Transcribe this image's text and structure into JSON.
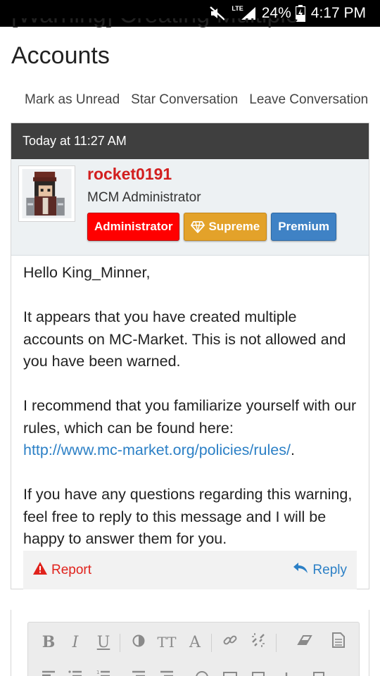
{
  "status_bar": {
    "battery": "24%",
    "time": "4:17 PM",
    "network": "LTE"
  },
  "thread": {
    "title_partial": "[Warning] Creating Multiple",
    "title_line2": "Accounts"
  },
  "actions": {
    "mark_unread": "Mark as Unread",
    "star": "Star Conversation",
    "leave": "Leave Conversation"
  },
  "message": {
    "date": "Today at 11:27 AM",
    "author": {
      "username": "rocket0191",
      "title": "MCM Administrator",
      "badges": {
        "admin": "Administrator",
        "supreme": "Supreme",
        "premium": "Premium"
      }
    },
    "body": {
      "greeting": "Hello King_Minner,",
      "p1": "It appears that you have created multiple accounts on MC-Market. This is not allowed and you have been warned.",
      "p2_text": "I recommend that you familiarize yourself with our rules, which can be found here:",
      "p2_link": "http://www.mc-market.org/policies/rules/",
      "p2_end": ".",
      "p3": "If you have any questions regarding this warning, feel free to reply to this message and I will be happy to answer them for you."
    },
    "footer": {
      "report": "Report",
      "reply": "Reply"
    }
  },
  "colors": {
    "username": "#d21f1f",
    "admin_badge": "#ff0000",
    "supreme_badge": "#e3a22a",
    "premium_badge": "#3f82c5",
    "link": "#2c80c6",
    "header_bg": "#3f3f3f"
  },
  "editor_toolbar": {
    "bold": "B",
    "italic": "I",
    "underline": "U",
    "text_size": "TT",
    "font": "A"
  }
}
